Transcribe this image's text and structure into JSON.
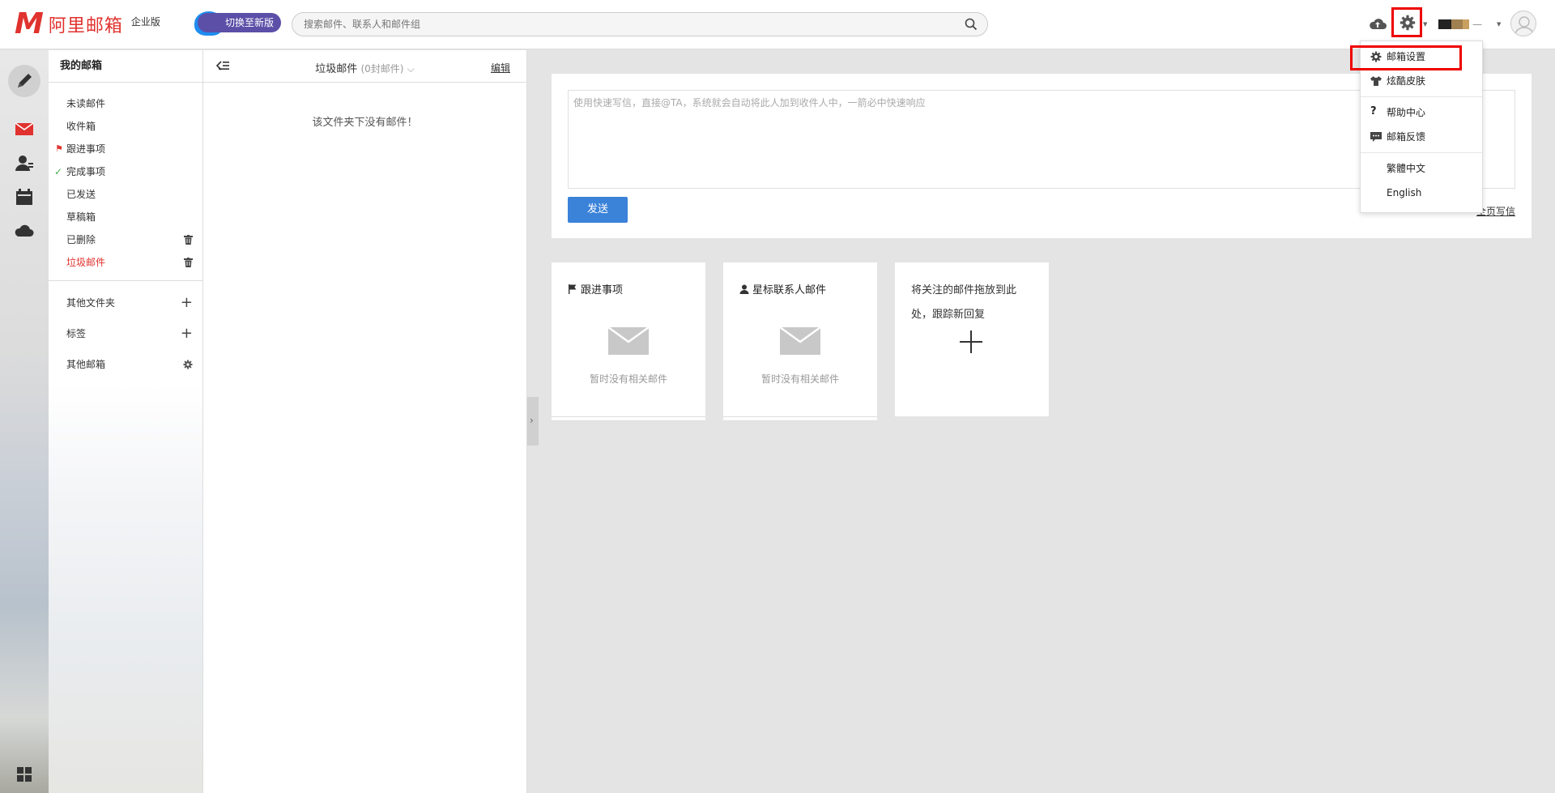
{
  "header": {
    "logo_letter": "M",
    "logo_text": "阿里邮箱",
    "edition": "企业版",
    "switch_label": "切换至新版",
    "search_placeholder": "搜索邮件、联系人和邮件组",
    "user_dash": "一"
  },
  "iconbar": {
    "items": [
      "compose-icon",
      "mail-icon",
      "contacts-icon",
      "calendar-icon",
      "cloud-icon",
      "apps-icon"
    ],
    "mail_color": "#e0322e"
  },
  "folders": {
    "title": "我的邮箱",
    "items": [
      {
        "label": "未读邮件"
      },
      {
        "label": "收件箱"
      },
      {
        "label": "跟进事项",
        "marker": "flag"
      },
      {
        "label": "完成事项",
        "marker": "check"
      },
      {
        "label": "已发送"
      },
      {
        "label": "草稿箱"
      },
      {
        "label": "已删除",
        "trash": true
      },
      {
        "label": "垃圾邮件",
        "trash": true,
        "active": true
      }
    ],
    "groups": [
      {
        "label": "其他文件夹",
        "action": "plus"
      },
      {
        "label": "标签",
        "action": "plus"
      },
      {
        "label": "其他邮箱",
        "action": "gear"
      }
    ]
  },
  "mail_list": {
    "title": "垃圾邮件",
    "count": "(0封邮件)",
    "edit_label": "编辑",
    "empty_message": "该文件夹下没有邮件！"
  },
  "quick_write": {
    "placeholder": "使用快速写信，直接@TA，系统就会自动将此人加到收件人中，一箭必中快速响应",
    "send_label": "发送",
    "full_label": "全页写信"
  },
  "cards": [
    {
      "title": "跟进事项",
      "icon": "flag-icon",
      "empty": "暂时没有相关邮件"
    },
    {
      "title": "星标联系人邮件",
      "icon": "person-icon",
      "empty": "暂时没有相关邮件"
    },
    {
      "drop_text": "将关注的邮件拖放到此处，跟踪新回复"
    }
  ],
  "dropdown": {
    "items": [
      {
        "label": "邮箱设置",
        "icon": "gear-icon"
      },
      {
        "label": "炫酷皮肤",
        "icon": "shirt-icon"
      },
      {
        "label": "帮助中心",
        "icon": "question-icon"
      },
      {
        "label": "邮箱反馈",
        "icon": "feedback-icon"
      },
      {
        "label": "繁體中文"
      },
      {
        "label": "English"
      }
    ]
  },
  "colors": {
    "brand_red": "#e0322e",
    "accent_blue": "#3b82d9",
    "switch_purple": "#5b4fa8",
    "highlight_red": "#ee0000"
  }
}
